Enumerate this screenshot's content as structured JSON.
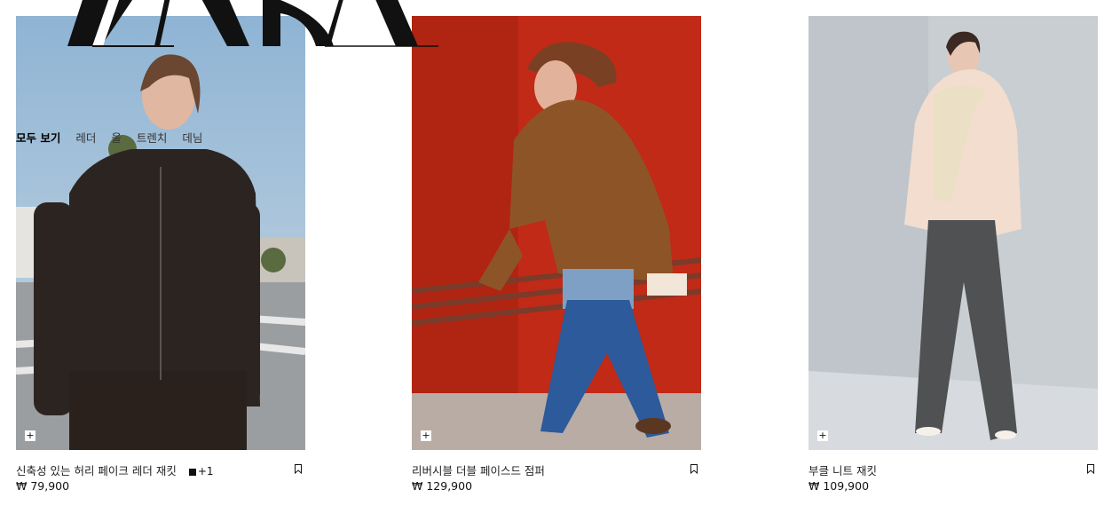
{
  "brand": {
    "logo_text": "ZARA"
  },
  "categories": [
    {
      "label": "모두 보기",
      "active": true
    },
    {
      "label": "레더",
      "active": false
    },
    {
      "label": "울",
      "active": false
    },
    {
      "label": "트렌치",
      "active": false
    },
    {
      "label": "데님",
      "active": false
    }
  ],
  "products": [
    {
      "name": "신축성 있는 허리 페이크 레더 재킷",
      "price": "₩ 79,900",
      "color_more": "+1",
      "add_icon": "plus-icon",
      "save_icon": "bookmark-icon"
    },
    {
      "name": "리버시블 더블 페이스드 점퍼",
      "price": "₩ 129,900",
      "add_icon": "plus-icon",
      "save_icon": "bookmark-icon"
    },
    {
      "name": "부클 니트 재킷",
      "price": "₩ 109,900",
      "add_icon": "plus-icon",
      "save_icon": "bookmark-icon"
    }
  ],
  "colors": {
    "text": "#111111",
    "background": "#ffffff"
  }
}
